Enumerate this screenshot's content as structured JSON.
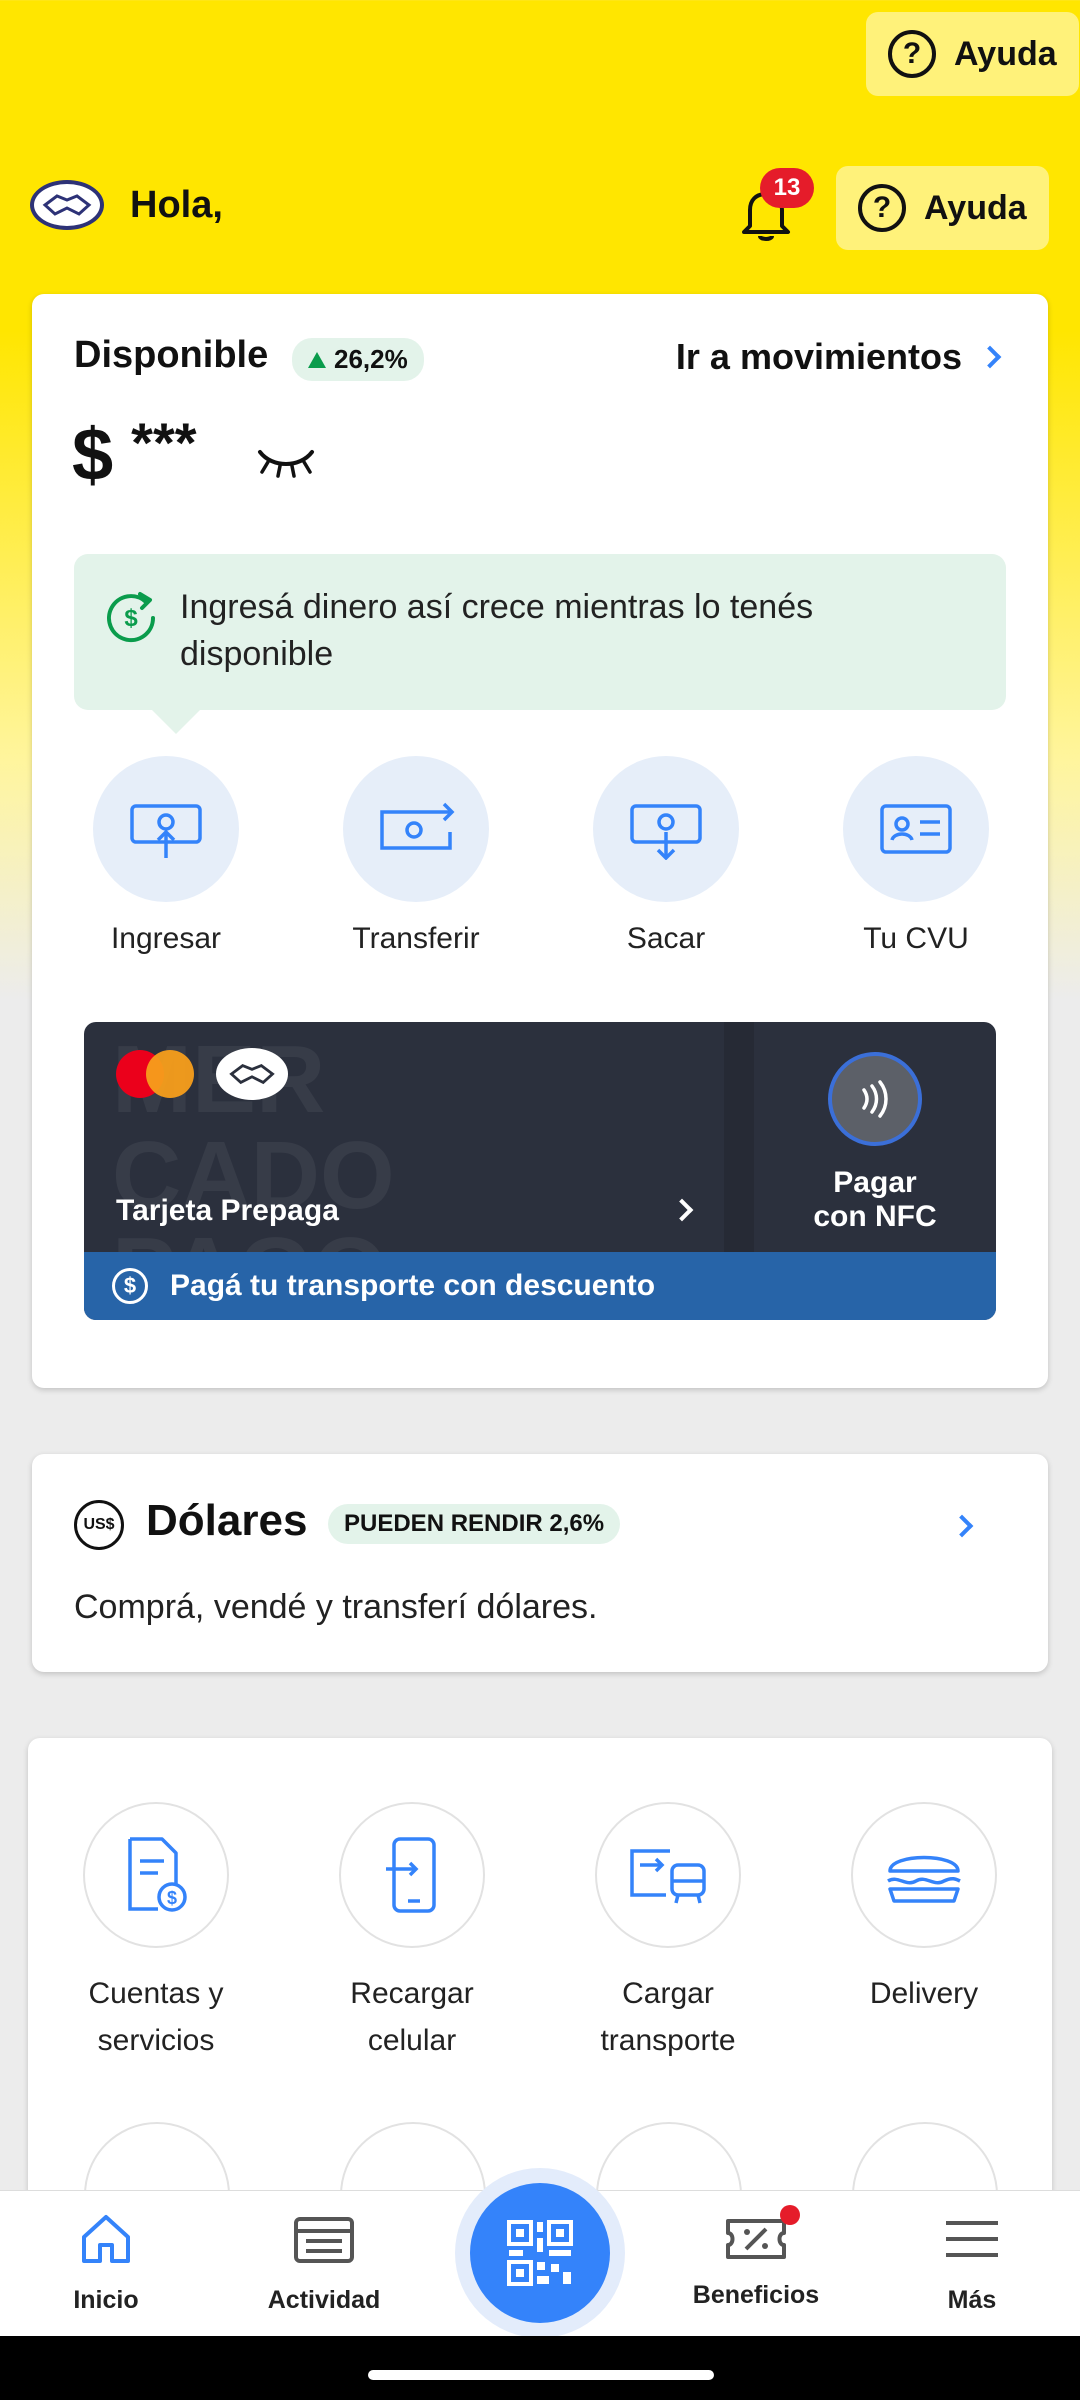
{
  "top": {
    "help_label": "Ayuda"
  },
  "header": {
    "greeting": "Hola,",
    "notifications_count": "13",
    "help_label": "Ayuda"
  },
  "balance_card": {
    "title": "Disponible",
    "yield_badge": "26,2%",
    "movements_link": "Ir a movimientos",
    "currency_symbol": "$",
    "hidden_amount": "***",
    "tip_text": "Ingresá dinero así crece mientras lo tenés disponible",
    "actions": [
      {
        "label": "Ingresar",
        "icon": "deposit-icon"
      },
      {
        "label": "Transferir",
        "icon": "transfer-icon"
      },
      {
        "label": "Sacar",
        "icon": "withdraw-icon"
      },
      {
        "label": "Tu CVU",
        "icon": "id-card-icon"
      }
    ],
    "prepaid_card": {
      "label": "Tarjeta Prepaga",
      "nfc_label_line1": "Pagar",
      "nfc_label_line2": "con NFC",
      "transport_promo": "Pagá tu transporte con descuento",
      "watermark_lines": [
        "MER",
        "CADO",
        "PAGO"
      ]
    }
  },
  "dollars_card": {
    "icon_text": "US$",
    "title": "Dólares",
    "badge": "PUEDEN RENDIR 2,6%",
    "description": "Comprá, vendé y transferí dólares."
  },
  "services": [
    {
      "line1": "Cuentas y",
      "line2": "servicios",
      "icon": "bill-icon"
    },
    {
      "line1": "Recargar",
      "line2": "celular",
      "icon": "phone-recharge-icon"
    },
    {
      "line1": "Cargar",
      "line2": "transporte",
      "icon": "transport-card-icon"
    },
    {
      "line1": "Delivery",
      "line2": "",
      "icon": "burger-icon"
    }
  ],
  "bottom_nav": [
    {
      "label": "Inicio",
      "icon": "home-icon",
      "active": true
    },
    {
      "label": "Actividad",
      "icon": "activity-icon",
      "active": false
    },
    {
      "label": "Beneficios",
      "icon": "coupon-icon",
      "active": false
    },
    {
      "label": "Más",
      "icon": "menu-icon",
      "active": false
    }
  ],
  "colors": {
    "brand_yellow": "#ffe600",
    "accent_blue": "#3483fa",
    "green": "#0a9c4c",
    "badge_red": "#e51c2a"
  }
}
